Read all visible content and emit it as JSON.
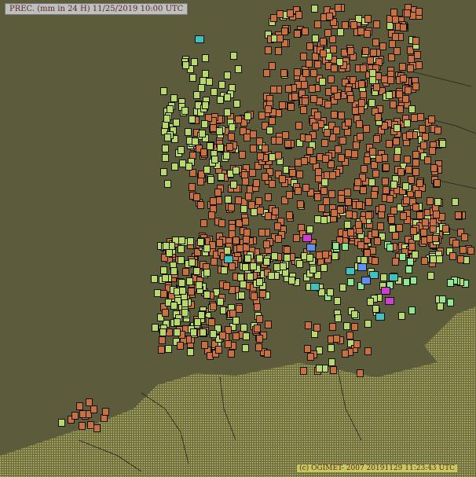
{
  "map": {
    "title": "PREC. (mm in 24 H)    11/25/2019 10:00 UTC",
    "credit": "(c) OGIMET- 2007  20191129 11:23:43 UTC",
    "colors": {
      "sea": "#5c5c3c",
      "land_hatch": "#b0b060",
      "border": "#202020",
      "dry": "#c87040",
      "light": "#b8d86c",
      "moderate": "#90e890",
      "heavy": "#40c0c0",
      "very_heavy": "#6090f0",
      "extreme": "#d040d0"
    },
    "icons": [
      "station-box-icon"
    ]
  }
}
